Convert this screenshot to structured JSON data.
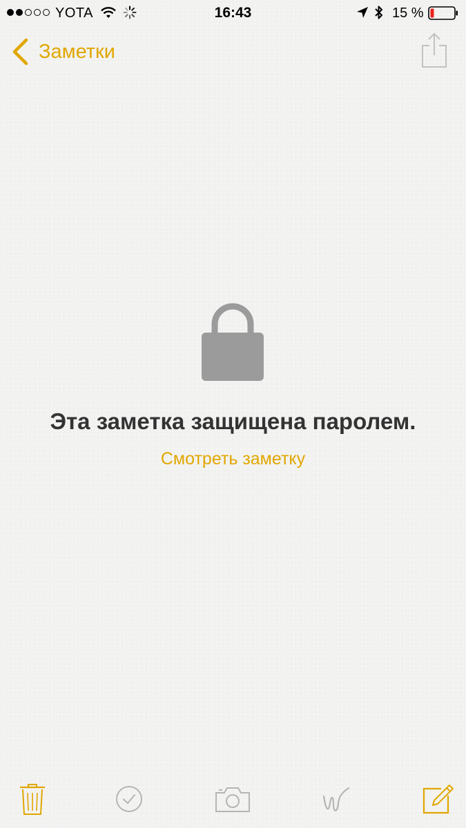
{
  "status_bar": {
    "signal_bars_total": 5,
    "signal_bars_filled": 2,
    "carrier": "YOTA",
    "time": "16:43",
    "battery_percent": "15 %",
    "battery_level": 0.15,
    "icons": [
      "wifi-icon",
      "activity-spinner-icon",
      "location-arrow-icon",
      "bluetooth-icon",
      "battery-icon"
    ]
  },
  "nav": {
    "back_label": "Заметки",
    "back_icon": "chevron-left-icon",
    "share_icon": "share-icon"
  },
  "locked": {
    "icon": "lock-icon",
    "title": "Эта заметка защищена паролем.",
    "action_label": "Смотреть заметку"
  },
  "toolbar": {
    "items": [
      {
        "icon": "trash-icon",
        "enabled": true
      },
      {
        "icon": "checklist-icon",
        "enabled": false
      },
      {
        "icon": "camera-icon",
        "enabled": false
      },
      {
        "icon": "sketch-icon",
        "enabled": false
      },
      {
        "icon": "compose-icon",
        "enabled": true
      }
    ]
  },
  "colors": {
    "accent": "#e1a700",
    "background": "#f2f2f1",
    "title_text": "#333333",
    "disabled_icon": "#b5b5b5",
    "lock_fill": "#9b9b9b",
    "battery_low": "#e8231c"
  }
}
